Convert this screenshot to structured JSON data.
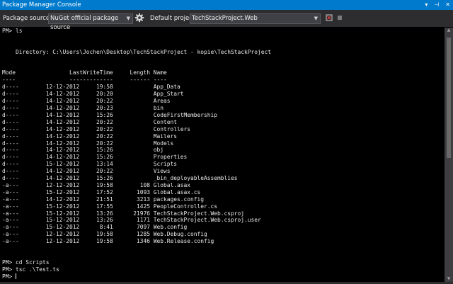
{
  "window": {
    "title": "Package Manager Console",
    "controls": {
      "dropdown": "▾",
      "pin": "⊣",
      "close": "✕"
    }
  },
  "toolbar": {
    "package_source_label": "Package source:",
    "package_source_value": "NuGet official package source",
    "default_project_label": "Default project:",
    "default_project_value": "TechStackProject.Web",
    "settings_icon": "gear-icon",
    "clear_icon": "clear-console-icon",
    "stop_icon": "stop-icon"
  },
  "console": {
    "lines": [
      "PM> ls",
      "",
      "",
      "    Directory: C:\\Users\\Jochen\\Desktop\\TechStackProject - kopie\\TechStackProject",
      "",
      "",
      "Mode                LastWriteTime     Length Name",
      "----                -------------     ------ ----",
      "d----        12-12-2012     19:58            App_Data",
      "d----        14-12-2012     20:20            App_Start",
      "d----        14-12-2012     20:22            Areas",
      "d----        14-12-2012     20:23            bin",
      "d----        14-12-2012     15:26            CodeFirstMembership",
      "d----        14-12-2012     20:22            Content",
      "d----        14-12-2012     20:22            Controllers",
      "d----        14-12-2012     20:22            Mailers",
      "d----        14-12-2012     20:22            Models",
      "d----        14-12-2012     15:26            obj",
      "d----        14-12-2012     15:26            Properties",
      "d----        15-12-2012     13:14            Scripts",
      "d----        14-12-2012     20:22            Views",
      "d----        14-12-2012     15:26            _bin_deployableAssemblies",
      "-a---        12-12-2012     19:58        108 Global.asax",
      "-a---        15-12-2012     17:52       1093 Global.asax.cs",
      "-a---        14-12-2012     21:51       3213 packages.config",
      "-a---        15-12-2012     17:55       1425 PeopleController.cs",
      "-a---        15-12-2012     13:26      21976 TechStackProject.Web.csproj",
      "-a---        15-12-2012     13:26       1171 TechStackProject.Web.csproj.user",
      "-a---        15-12-2012      8:41       7097 Web.config",
      "-a---        12-12-2012     19:58       1285 Web.Debug.config",
      "-a---        12-12-2012     19:58       1346 Web.Release.config",
      "",
      "",
      "PM> cd Scripts",
      "PM> tsc .\\Test.ts",
      "PM> "
    ]
  },
  "colors": {
    "title_bar": "#007acc",
    "toolbar": "#2d2d30",
    "console_background": "#000000",
    "console_text": "#e6e6e6",
    "scrollbar_track": "#3e3e42",
    "scrollbar_thumb": "#686868"
  }
}
